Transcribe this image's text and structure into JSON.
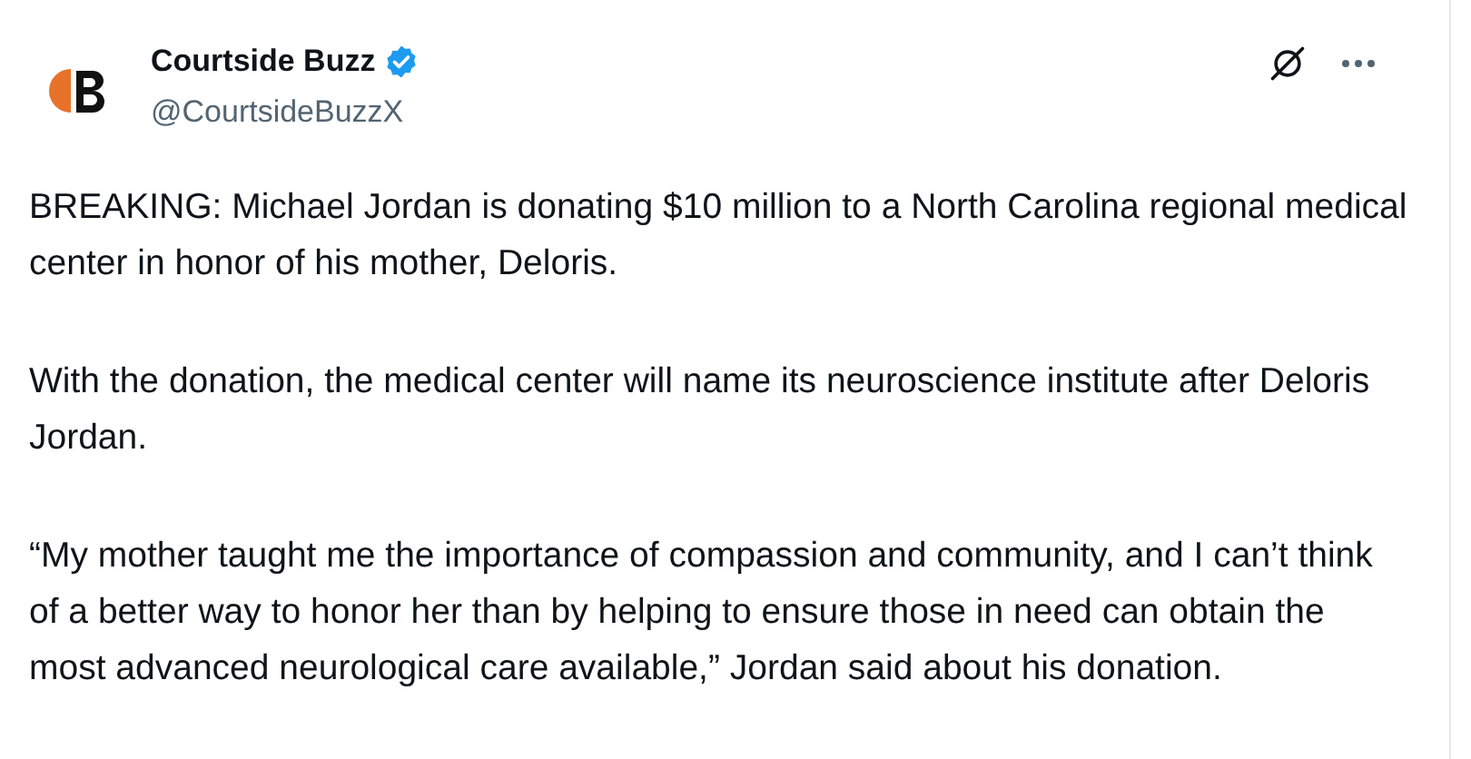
{
  "post": {
    "author": {
      "name": "Courtside Buzz",
      "handle": "@CourtsideBuzzX",
      "verified": true
    },
    "paragraphs": [
      "BREAKING: Michael Jordan is donating $10 million to a North Carolina regional medical center in honor of his mother, Deloris.",
      "With the donation, the medical center will name its neuroscience institute after Deloris Jordan.",
      "“My mother taught me the importance of compassion and community, and I can’t think of a better way to honor her than by helping to ensure those in need can obtain the most advanced neurological care available,” Jordan said about his donation."
    ]
  }
}
